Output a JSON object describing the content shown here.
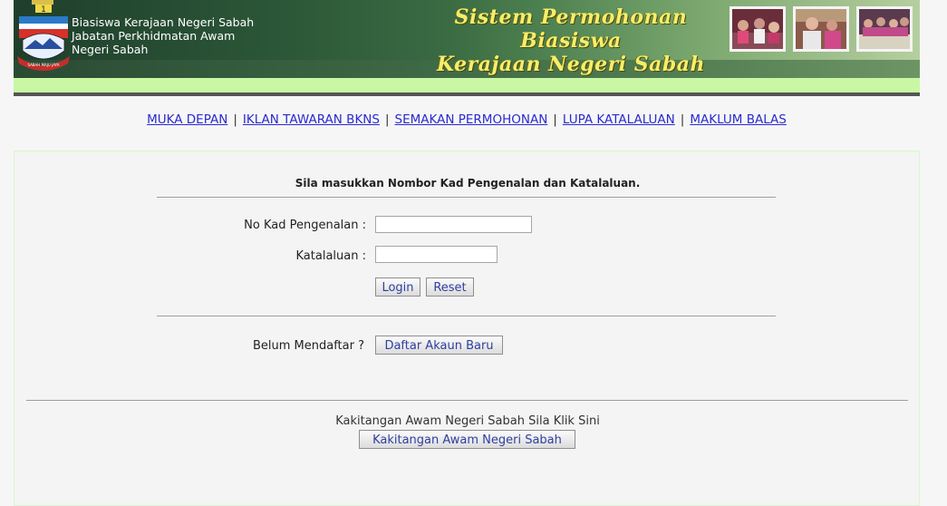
{
  "header": {
    "org_line1": "Biasiswa Kerajaan Negeri Sabah",
    "org_line2": "Jabatan Perkhidmatan Awam",
    "org_line3": "Negeri Sabah",
    "system_title_line1": "Sistem Permohonan Biasiswa",
    "system_title_line2": "Kerajaan Negeri Sabah",
    "crest_motto": "SABAH MAJU JAYA"
  },
  "nav": {
    "items": [
      {
        "label": "MUKA DEPAN"
      },
      {
        "label": "IKLAN TAWARAN BKNS"
      },
      {
        "label": "SEMAKAN PERMOHONAN"
      },
      {
        "label": "LUPA KATALALUAN"
      },
      {
        "label": "MAKLUM BALAS"
      }
    ],
    "separator": "|"
  },
  "login": {
    "instruction": "Sila masukkan Nombor Kad Pengenalan dan Katalaluan.",
    "ic_label": "No Kad Pengenalan :",
    "ic_value": "",
    "password_label": "Katalaluan :",
    "password_value": "",
    "login_button": "Login",
    "reset_button": "Reset"
  },
  "register": {
    "prompt": "Belum Mendaftar ?",
    "button": "Daftar Akaun Baru"
  },
  "staff": {
    "text": "Kakitangan Awam Negeri Sabah Sila Klik Sini",
    "button": "Kakitangan Awam Negeri Sabah"
  },
  "colors": {
    "link": "#2b2bd0",
    "green_bar": "#c9f7a4",
    "title_yellow": "#f4ee6a",
    "button_text": "#2e3fa0"
  }
}
